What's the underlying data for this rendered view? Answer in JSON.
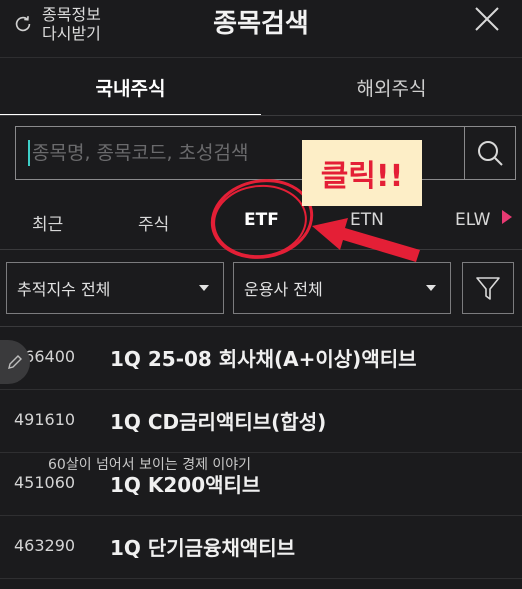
{
  "header": {
    "refresh_label": "종목정보\n다시받기",
    "title": "종목검색"
  },
  "tabs": [
    {
      "label": "국내주식",
      "active": true
    },
    {
      "label": "해외주식",
      "active": false
    }
  ],
  "search": {
    "placeholder": "종목명, 종목코드, 초성검색",
    "value": ""
  },
  "categories": [
    {
      "label": "최근",
      "active": false
    },
    {
      "label": "주식",
      "active": false
    },
    {
      "label": "ETF",
      "active": true
    },
    {
      "label": "ETN",
      "active": false
    },
    {
      "label": "ELW",
      "active": false
    }
  ],
  "filters": {
    "index": "추적지수 전체",
    "manager": "운용사 전체"
  },
  "results": [
    {
      "code": "466400",
      "name": "1Q 25-08 회사채(A+이상)액티브"
    },
    {
      "code": "491610",
      "name": "1Q CD금리액티브(합성)"
    },
    {
      "code": "451060",
      "name": "1Q K200액티브"
    },
    {
      "code": "463290",
      "name": "1Q 단기금융채액티브"
    }
  ],
  "overlay_text": "60살이 넘어서 보이는 경제 이야기",
  "annotation": {
    "label": "클릭!!",
    "color": "#e41f36",
    "box_color": "#fdeec7"
  },
  "colors": {
    "background": "#1b1b1d",
    "accent": "#3ecfc8",
    "scroll_arrow": "#e83a73"
  }
}
